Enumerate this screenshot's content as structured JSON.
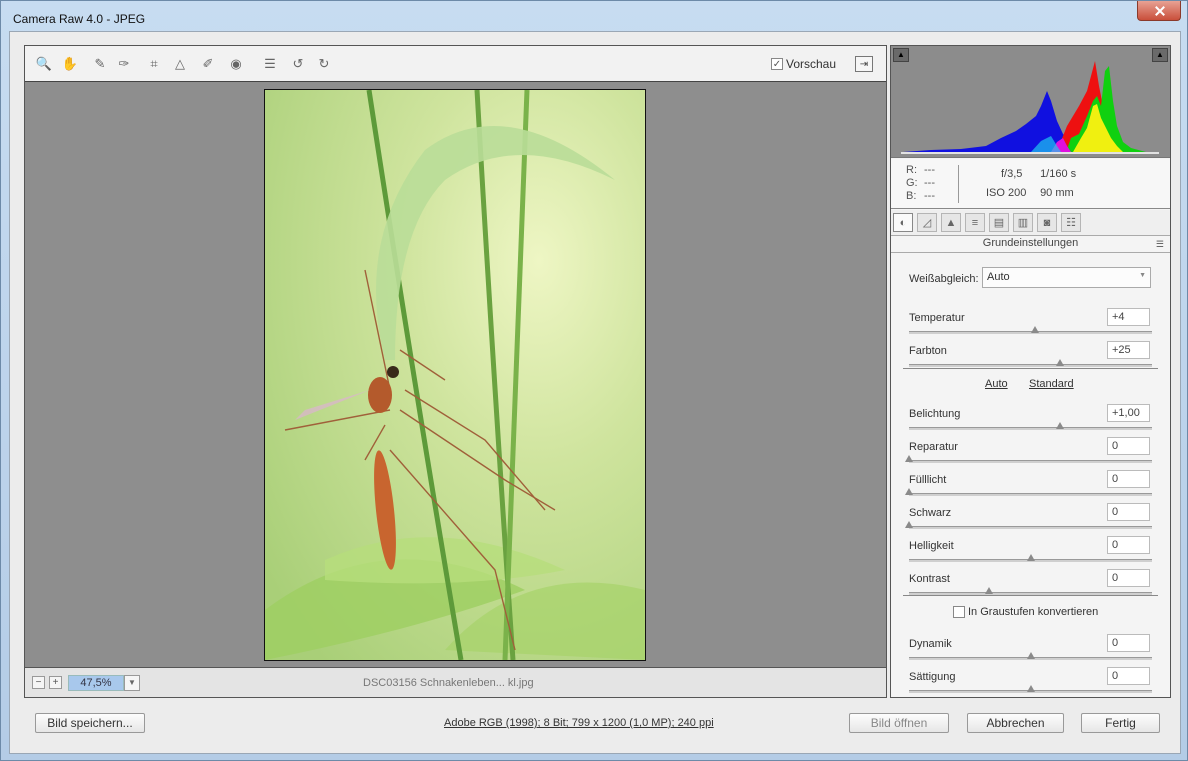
{
  "window": {
    "title": "Camera Raw 4.0 - JPEG"
  },
  "toolbar": {
    "tools": [
      {
        "name": "zoom-tool-icon",
        "glyph": "🔍"
      },
      {
        "name": "hand-tool-icon",
        "glyph": "✋"
      },
      {
        "name": "white-balance-tool-icon",
        "glyph": "✎"
      },
      {
        "name": "color-sampler-tool-icon",
        "glyph": "✑"
      },
      {
        "name": "crop-tool-icon",
        "glyph": "⌗"
      },
      {
        "name": "straighten-tool-icon",
        "glyph": "△"
      },
      {
        "name": "retouch-tool-icon",
        "glyph": "✐"
      },
      {
        "name": "red-eye-tool-icon",
        "glyph": "◉"
      },
      {
        "name": "preferences-icon",
        "glyph": "☰"
      },
      {
        "name": "rotate-left-icon",
        "glyph": "↺"
      },
      {
        "name": "rotate-right-icon",
        "glyph": "↻"
      }
    ],
    "preview_label": "Vorschau",
    "preview_checked": true
  },
  "status": {
    "zoom_value": "47,5%",
    "filename": "DSC03156 Schnakenleben... kl.jpg"
  },
  "readout": {
    "r_label": "R:",
    "r_value": "---",
    "g_label": "G:",
    "g_value": "---",
    "b_label": "B:",
    "b_value": "---",
    "aperture": "f/3,5",
    "shutter": "1/160 s",
    "iso": "ISO 200",
    "focal": "90 mm"
  },
  "panel": {
    "title": "Grundeinstellungen",
    "white_balance_label": "Weißabgleich:",
    "white_balance_value": "Auto",
    "auto_link": "Auto",
    "standard_link": "Standard",
    "grayscale_label": "In Graustufen konvertieren",
    "sliders": [
      {
        "label": "Temperatur",
        "value": "+4",
        "position": 0.52
      },
      {
        "label": "Farbton",
        "value": "+25",
        "position": 0.62
      },
      {
        "label": "Belichtung",
        "value": "+1,00",
        "position": 0.62
      },
      {
        "label": "Reparatur",
        "value": "0",
        "position": 0.0
      },
      {
        "label": "Fülllicht",
        "value": "0",
        "position": 0.0
      },
      {
        "label": "Schwarz",
        "value": "0",
        "position": 0.0
      },
      {
        "label": "Helligkeit",
        "value": "0",
        "position": 0.5
      },
      {
        "label": "Kontrast",
        "value": "0",
        "position": 0.33
      },
      {
        "label": "Dynamik",
        "value": "0",
        "position": 0.5
      },
      {
        "label": "Sättigung",
        "value": "0",
        "position": 0.5
      }
    ]
  },
  "bottom": {
    "save_label": "Bild speichern...",
    "workflow_text": "Adobe RGB (1998); 8 Bit; 799 x 1200 (1,0 MP); 240 ppi",
    "open_label": "Bild öffnen",
    "cancel_label": "Abbrechen",
    "done_label": "Fertig"
  },
  "colors": {
    "accent": "#a8c8ec",
    "canvas_bg": "#8e8e8e",
    "histogram_bg": "#8c8c8c"
  }
}
